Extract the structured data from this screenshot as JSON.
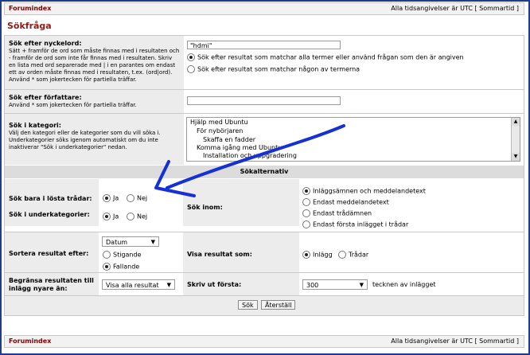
{
  "header": {
    "forum_index": "Forumindex",
    "timezone_text": "Alla tidsangivelser är UTC [ Sommartid ]"
  },
  "page_title": "Sökfråga",
  "keywords": {
    "label": "Sök efter nyckelord:",
    "help": "Sätt + framför de ord som måste finnas med i resultaten och - framför de ord som inte får finnas med i resultaten. Skriv en lista med ord separerade med | i en parantes om endast ett av orden måste finnas med i resultaten, t.ex. (ord|ord). Använd * som jokertecken för partiella träffar.",
    "value": "\"hdmi\"",
    "opt_all": "Sök efter resultat som matchar alla termer eller använd frågan som den är angiven",
    "opt_any": "Sök efter resultat som matchar någon av termerna"
  },
  "author": {
    "label": "Sök efter författare:",
    "help": "Använd * som jokertecken för partiella träffar.",
    "value": ""
  },
  "category": {
    "label": "Sök i kategori:",
    "help": "Välj den kategori eller de kategorier som du vill söka i. Underkategorier söks igenom automatiskt om du inte inaktiverar \"Sök i underkategorier\" nedan.",
    "options": [
      "Hjälp med Ubuntu",
      "För nybörjaren",
      "Skaffa en fadder",
      "Komma igång med Ubuntu",
      "Installation och uppgradering"
    ]
  },
  "options_title": "Sökalternativ",
  "solved": {
    "label": "Sök bara i lösta trådar:",
    "yes": "Ja",
    "no": "Nej"
  },
  "subcat": {
    "label": "Sök i underkategorier:",
    "yes": "Ja",
    "no": "Nej"
  },
  "search_in": {
    "label": "Sök inom:",
    "opts": [
      "Inläggsämnen och meddelandetext",
      "Endast meddelandetext",
      "Endast trådämnen",
      "Endast första inlägget i trådar"
    ]
  },
  "sort": {
    "label": "Sortera resultat efter:",
    "selected": "Datum",
    "asc": "Stigande",
    "desc": "Fallande"
  },
  "show_as": {
    "label": "Visa resultat som:",
    "posts": "Inlägg",
    "threads": "Trådar"
  },
  "limit": {
    "label": "Begränsa resultaten till inlägg nyare än:",
    "selected": "Visa alla resultat"
  },
  "print_first": {
    "label": "Skriv ut första:",
    "selected": "300",
    "suffix": "tecknen av inlägget"
  },
  "buttons": {
    "search": "Sök",
    "reset": "Återställ"
  },
  "footer": {
    "forum_index": "Forumindex",
    "timezone_text": "Alla tidsangivelser är UTC [ Sommartid ]"
  },
  "annotation_color": "#1531d6"
}
